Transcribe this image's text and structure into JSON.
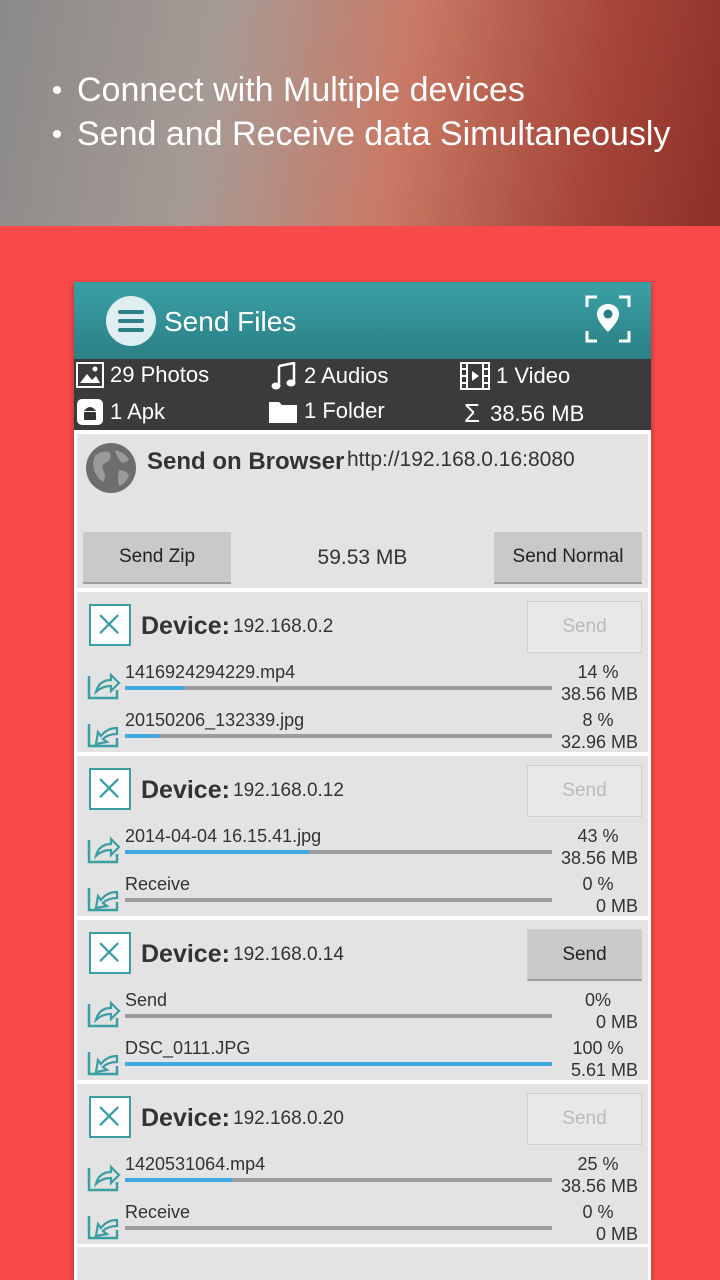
{
  "banner": {
    "bullets": [
      "Connect with Multiple devices",
      "Send and Receive data Simultaneously"
    ]
  },
  "appbar": {
    "title": "Send Files",
    "menu_icon": "menu-icon",
    "location_icon": "location-pin-icon"
  },
  "stats": {
    "photos": "29 Photos",
    "audios": "2 Audios",
    "video": "1 Video",
    "apk": "1 Apk",
    "folder": "1 Folder",
    "total": "38.56 MB"
  },
  "browser": {
    "title": "Send on Browser",
    "url": "http://192.168.0.16:8080",
    "send_zip": "Send Zip",
    "size": "59.53 MB",
    "send_normal": "Send Normal"
  },
  "device_label": "Device:",
  "devices": [
    {
      "ip": "192.168.0.2",
      "send": "Send",
      "send_enabled": false,
      "transfers": [
        {
          "name": "1416924294229.mp4",
          "percent": "14 %",
          "size": "38.56 MB",
          "progress": 0.14
        },
        {
          "name": "20150206_132339.jpg",
          "percent": "8 %",
          "size": "32.96 MB",
          "progress": 0.08
        }
      ]
    },
    {
      "ip": "192.168.0.12",
      "send": "Send",
      "send_enabled": false,
      "transfers": [
        {
          "name": "2014-04-04 16.15.41.jpg",
          "percent": "43 %",
          "size": "38.56 MB",
          "progress": 0.43
        },
        {
          "name": "Receive",
          "percent": "0 %",
          "size": "0 MB",
          "progress": 0
        }
      ]
    },
    {
      "ip": "192.168.0.14",
      "send": "Send",
      "send_enabled": true,
      "transfers": [
        {
          "name": "Send",
          "percent": "0%",
          "size": "0 MB",
          "progress": 0
        },
        {
          "name": "DSC_0111.JPG",
          "percent": "100 %",
          "size": "5.61 MB",
          "progress": 1.0
        }
      ]
    },
    {
      "ip": "192.168.0.20",
      "send": "Send",
      "send_enabled": false,
      "transfers": [
        {
          "name": "1420531064.mp4",
          "percent": "25 %",
          "size": "38.56 MB",
          "progress": 0.25
        },
        {
          "name": "Receive",
          "percent": "0 %",
          "size": "0 MB",
          "progress": 0
        }
      ]
    }
  ],
  "colors": {
    "accent": "#2a8086",
    "progress": "#3fa9e0",
    "background": "#f84a4a"
  }
}
